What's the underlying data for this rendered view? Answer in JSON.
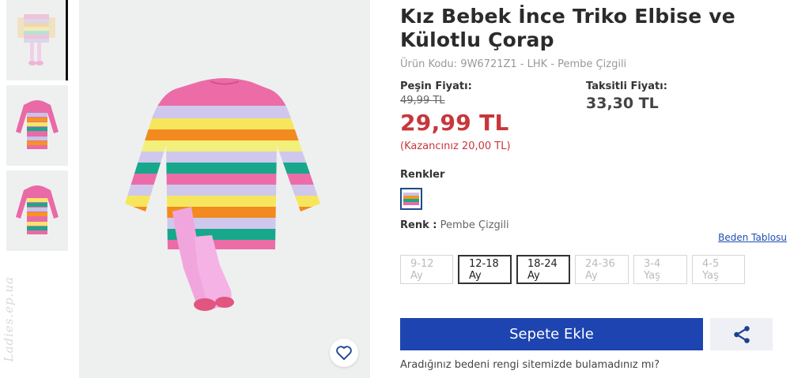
{
  "product": {
    "title": "Kız Bebek İnce Triko Elbise ve Külotlu Çorap",
    "code": "Ürün Kodu: 9W6721Z1 - LHK - Pembe Çizgili"
  },
  "pricing": {
    "cash_label": "Peşin Fiyatı:",
    "old_price": "49,99 TL",
    "new_price": "29,99 TL",
    "saving": "(Kazancınız 20,00 TL)",
    "installment_label": "Taksitli Fiyatı:",
    "installment_price": "33,30 TL"
  },
  "colors": {
    "label": "Renkler",
    "selected_label": "Renk :",
    "selected_value": "Pembe Çizgili"
  },
  "sizes": {
    "guide_link": "Beden Tablosu",
    "options": [
      {
        "label": "9-12 Ay",
        "available": false
      },
      {
        "label": "12-18 Ay",
        "available": true
      },
      {
        "label": "18-24 Ay",
        "available": true
      },
      {
        "label": "24-36 Ay",
        "available": false
      },
      {
        "label": "3-4 Yaş",
        "available": false
      },
      {
        "label": "4-5 Yaş",
        "available": false
      }
    ]
  },
  "actions": {
    "add_to_cart": "Sepete Ekle",
    "help_text": "Aradığınız bedeni rengi sitemizde bulamadınız mı?"
  },
  "watermark": "Ladies.ep.ua",
  "icons": {
    "favorite": "heart-outline-icon",
    "share": "share-icon"
  },
  "theme": {
    "accent": "#1d44b0",
    "sale": "#c8363b",
    "link": "#1d4fb2"
  }
}
